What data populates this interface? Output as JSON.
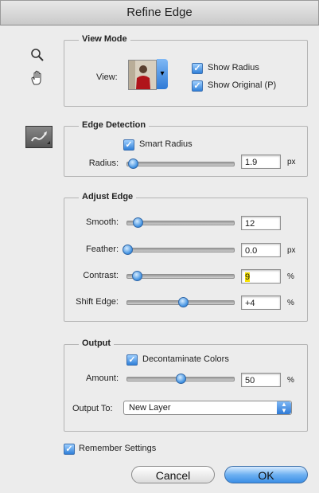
{
  "window": {
    "title": "Refine Edge"
  },
  "tools": {
    "zoom_icon": "magnifier",
    "hand_icon": "hand",
    "refine_icon": "refine-radius-brush"
  },
  "view_mode": {
    "legend": "View Mode",
    "view_label": "View:",
    "show_radius": {
      "label": "Show Radius",
      "checked": true
    },
    "show_original": {
      "label": "Show Original (P)",
      "checked": true
    }
  },
  "edge_detection": {
    "legend": "Edge Detection",
    "smart_radius": {
      "label": "Smart Radius",
      "checked": true
    },
    "radius": {
      "label": "Radius:",
      "value": "1.9",
      "unit": "px",
      "fraction": 0.05
    }
  },
  "adjust_edge": {
    "legend": "Adjust Edge",
    "smooth": {
      "label": "Smooth:",
      "value": "12",
      "unit": "",
      "fraction": 0.1
    },
    "feather": {
      "label": "Feather:",
      "value": "0.0",
      "unit": "px",
      "fraction": 0.0
    },
    "contrast": {
      "label": "Contrast:",
      "value": "9",
      "unit": "%",
      "fraction": 0.09
    },
    "shift_edge": {
      "label": "Shift Edge:",
      "value": "+4",
      "unit": "%",
      "fraction": 0.52
    }
  },
  "output": {
    "legend": "Output",
    "decontaminate": {
      "label": "Decontaminate Colors",
      "checked": true
    },
    "amount": {
      "label": "Amount:",
      "value": "50",
      "unit": "%",
      "fraction": 0.5
    },
    "output_to_label": "Output To:",
    "output_to_value": "New Layer"
  },
  "remember": {
    "label": "Remember Settings",
    "checked": true
  },
  "buttons": {
    "cancel": "Cancel",
    "ok": "OK"
  },
  "colors": {
    "accent": "#3b8ee6",
    "highlight": "#f7e200"
  }
}
